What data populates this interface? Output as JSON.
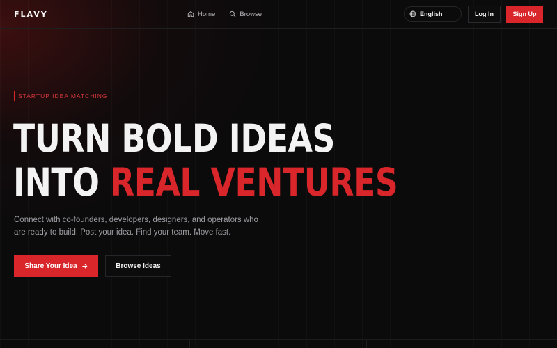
{
  "header": {
    "logo": "FLAVY",
    "nav": [
      {
        "label": "Home",
        "icon": "home-icon"
      },
      {
        "label": "Browse",
        "icon": "search-icon"
      }
    ],
    "language": {
      "label": "English",
      "icon": "globe-icon"
    },
    "login_label": "Log In",
    "signup_label": "Sign Up"
  },
  "hero": {
    "eyebrow": "STARTUP IDEA MATCHING",
    "headline_line1": "TURN BOLD IDEAS",
    "headline_line2_plain": "INTO ",
    "headline_line2_accent": "REAL VENTURES",
    "subcopy": "Connect with co-founders, developers, designers, and operators who are ready to build. Post your idea. Find your team. Move fast.",
    "primary_cta": "Share Your Idea",
    "secondary_cta": "Browse Ideas"
  },
  "colors": {
    "accent": "#d8262b",
    "background": "#0b0b0c"
  }
}
